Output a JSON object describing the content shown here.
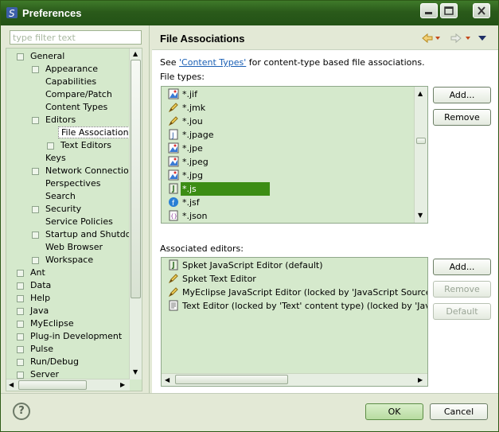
{
  "window": {
    "title": "Preferences"
  },
  "filter": {
    "placeholder": "type filter text"
  },
  "tree": [
    {
      "label": "General",
      "level": 0,
      "expanded": true
    },
    {
      "label": "Appearance",
      "level": 1,
      "expandable": true
    },
    {
      "label": "Capabilities",
      "level": 1
    },
    {
      "label": "Compare/Patch",
      "level": 1
    },
    {
      "label": "Content Types",
      "level": 1
    },
    {
      "label": "Editors",
      "level": 1,
      "expanded": true
    },
    {
      "label": "File Associations",
      "level": 2,
      "selected": true
    },
    {
      "label": "Text Editors",
      "level": 2,
      "expandable": true
    },
    {
      "label": "Keys",
      "level": 1
    },
    {
      "label": "Network Connections",
      "level": 1,
      "expandable": true
    },
    {
      "label": "Perspectives",
      "level": 1
    },
    {
      "label": "Search",
      "level": 1
    },
    {
      "label": "Security",
      "level": 1,
      "expandable": true
    },
    {
      "label": "Service Policies",
      "level": 1
    },
    {
      "label": "Startup and Shutdown",
      "level": 1,
      "expandable": true
    },
    {
      "label": "Web Browser",
      "level": 1
    },
    {
      "label": "Workspace",
      "level": 1,
      "expandable": true
    },
    {
      "label": "Ant",
      "level": 0,
      "expandable": true
    },
    {
      "label": "Data",
      "level": 0,
      "expandable": true
    },
    {
      "label": "Help",
      "level": 0,
      "expandable": true
    },
    {
      "label": "Java",
      "level": 0,
      "expandable": true
    },
    {
      "label": "MyEclipse",
      "level": 0,
      "expandable": true
    },
    {
      "label": "Plug-in Development",
      "level": 0,
      "expandable": true
    },
    {
      "label": "Pulse",
      "level": 0,
      "expandable": true
    },
    {
      "label": "Run/Debug",
      "level": 0,
      "expandable": true
    },
    {
      "label": "Server",
      "level": 0,
      "expandable": true
    }
  ],
  "page": {
    "title": "File Associations",
    "see_prefix": "See ",
    "see_link": "'Content Types'",
    "see_suffix": " for content-type based file associations.",
    "file_types_label": "File types:",
    "associated_label": "Associated editors:"
  },
  "file_types": [
    {
      "name": "*.jif",
      "icon": "image-file-icon"
    },
    {
      "name": "*.jmk",
      "icon": "pencil-file-icon"
    },
    {
      "name": "*.jou",
      "icon": "pencil-file-icon"
    },
    {
      "name": "*.jpage",
      "icon": "java-page-icon"
    },
    {
      "name": "*.jpe",
      "icon": "image-file-icon"
    },
    {
      "name": "*.jpeg",
      "icon": "image-file-icon"
    },
    {
      "name": "*.jpg",
      "icon": "image-file-icon"
    },
    {
      "name": "*.js",
      "icon": "javascript-file-icon",
      "selected": true
    },
    {
      "name": "*.jsf",
      "icon": "jsf-file-icon"
    },
    {
      "name": "*.json",
      "icon": "json-file-icon"
    }
  ],
  "editors": [
    {
      "name": "Spket JavaScript Editor (default)",
      "icon": "javascript-file-icon"
    },
    {
      "name": "Spket Text Editor",
      "icon": "pencil-file-icon"
    },
    {
      "name": "MyEclipse JavaScript Editor (locked by 'JavaScript Source File' con",
      "icon": "pencil-file-icon"
    },
    {
      "name": "Text Editor (locked by 'Text' content type) (locked by 'JavaScript",
      "icon": "text-file-icon"
    }
  ],
  "buttons": {
    "add_types": "Add...",
    "remove_types": "Remove",
    "add_editor": "Add...",
    "remove_editor": "Remove",
    "default": "Default",
    "ok": "OK",
    "cancel": "Cancel"
  },
  "help": {
    "glyph": "?"
  }
}
